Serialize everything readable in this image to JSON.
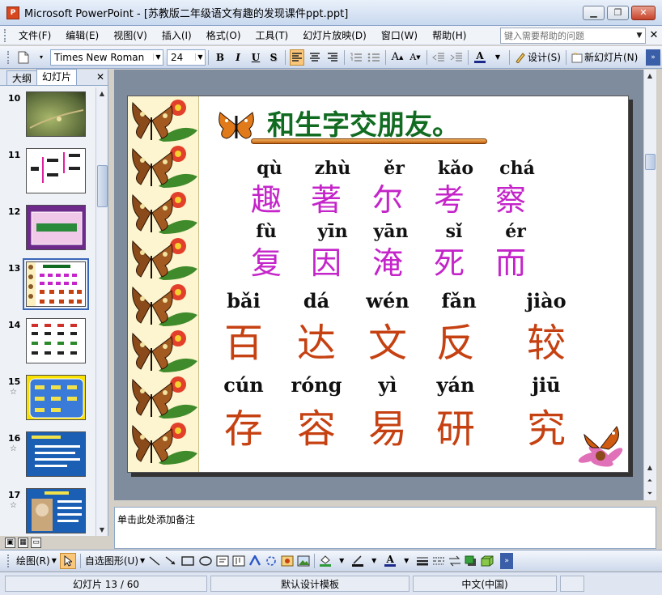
{
  "window": {
    "title": "Microsoft PowerPoint - [苏教版二年级语文有趣的发现课件ppt.ppt]",
    "app_icon": "P"
  },
  "menu": {
    "items": [
      "文件(F)",
      "编辑(E)",
      "视图(V)",
      "插入(I)",
      "格式(O)",
      "工具(T)",
      "幻灯片放映(D)",
      "窗口(W)",
      "帮助(H)"
    ],
    "help_placeholder": "键入需要帮助的问题"
  },
  "toolbar": {
    "font_name": "Times New Roman",
    "font_size": "24",
    "bold": "B",
    "italic": "I",
    "underline": "U",
    "shadow": "S",
    "design_label": "设计(S)",
    "new_slide_label": "新幻灯片(N)"
  },
  "leftpane": {
    "tabs": [
      "大纲",
      "幻灯片"
    ],
    "thumbs": [
      {
        "num": "10",
        "star": ""
      },
      {
        "num": "11",
        "star": ""
      },
      {
        "num": "12",
        "star": ""
      },
      {
        "num": "13",
        "star": ""
      },
      {
        "num": "14",
        "star": ""
      },
      {
        "num": "15",
        "star": "☆"
      },
      {
        "num": "16",
        "star": "☆"
      },
      {
        "num": "17",
        "star": "☆"
      }
    ],
    "selected_index": 3
  },
  "slide": {
    "title": "和生字交朋友。",
    "row1_pinyin": [
      "qù",
      "zhù",
      "ěr",
      "kǎo",
      "chá"
    ],
    "row1_chars": [
      "趣",
      "著",
      "尔",
      "考",
      "察"
    ],
    "row2_pinyin": [
      "fù",
      "yīn",
      "yān",
      "sǐ",
      "ér"
    ],
    "row2_chars": [
      "复",
      "因",
      "淹",
      "死",
      "而"
    ],
    "row3_pinyin": [
      "bǎi",
      "dá",
      "wén",
      "fǎn",
      "jiào"
    ],
    "row3_chars": [
      "百",
      "达",
      "文",
      "反",
      "较"
    ],
    "row4_pinyin": [
      "cún",
      "róng",
      "yì",
      "yán",
      "jiū"
    ],
    "row4_chars": [
      "存",
      "容",
      "易",
      "研",
      "究"
    ],
    "colors": {
      "title": "#116b21",
      "purple": "#c424c9",
      "orange": "#c64112"
    }
  },
  "notes": {
    "placeholder": "单击此处添加备注"
  },
  "drawing": {
    "draw_label": "绘图(R)",
    "autoshape_label": "自选图形(U)"
  },
  "status": {
    "slide_info": "幻灯片 13 / 60",
    "template": "默认设计模板",
    "language": "中文(中国)"
  }
}
